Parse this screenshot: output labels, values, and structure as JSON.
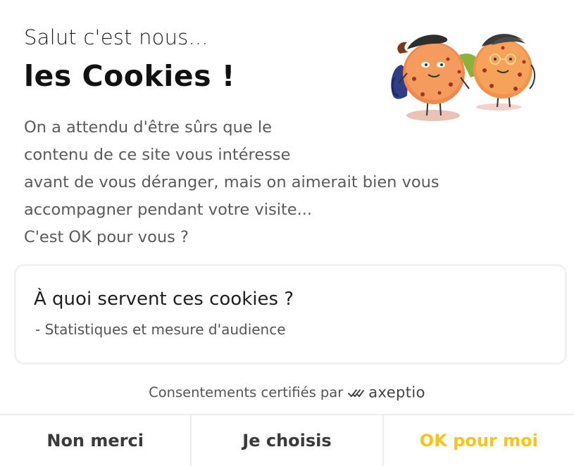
{
  "banner": {
    "greeting": "Salut c'est nous...",
    "headline": "les Cookies !",
    "intro_lines": [
      "On a attendu d'être sûrs que le",
      "contenu de ce site vous intéresse",
      "avant de vous déranger, mais on aimerait bien vous",
      "accompagner pendant votre visite...",
      "C'est OK pour vous ?"
    ],
    "illustration_icon": "cookie-mascots-icon"
  },
  "purpose": {
    "title": "À quoi servent ces cookies ?",
    "items": [
      "- Statistiques et mesure d'audience"
    ]
  },
  "certification": {
    "prefix": "Consentements certifiés par",
    "brand_icon": "axeptio-logo-icon",
    "brand_name": "axeptio"
  },
  "buttons": {
    "decline": "Non merci",
    "choose": "Je choisis",
    "accept": "OK pour moi"
  },
  "colors": {
    "accent": "#f5c518",
    "text_muted": "#5a5a5a"
  }
}
